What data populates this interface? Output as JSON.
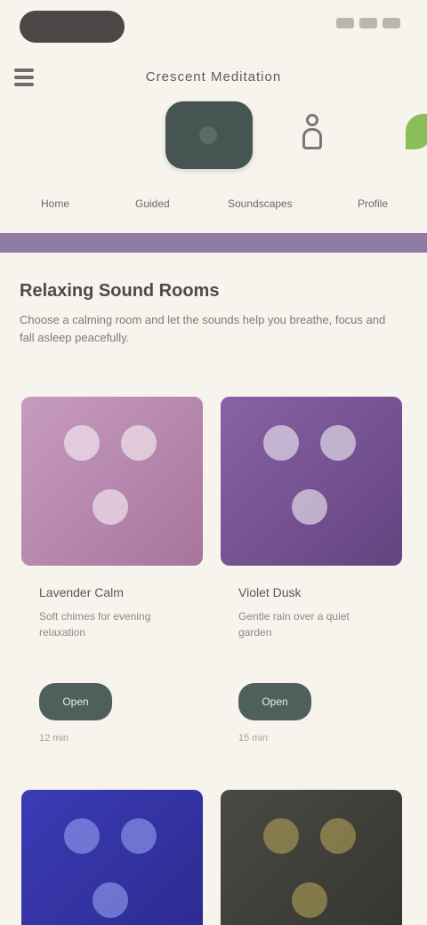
{
  "app": {
    "title": "Crescent Meditation"
  },
  "header": {
    "mode_label": ""
  },
  "tabs": [
    "Home",
    "Guided",
    "Soundscapes",
    "Profile"
  ],
  "section": {
    "title": "Relaxing Sound Rooms",
    "description": "Choose a calming room and let the sounds help you breathe, focus and fall asleep peacefully."
  },
  "cards": [
    {
      "name": "Lavender Calm",
      "meta": "Soft chimes for evening relaxation",
      "button": "Open",
      "caption": "12 min"
    },
    {
      "name": "Violet Dusk",
      "meta": "Gentle rain over a quiet garden",
      "button": "Open",
      "caption": "15 min"
    },
    {
      "name": "",
      "meta": "",
      "button": "",
      "caption": ""
    },
    {
      "name": "",
      "meta": "",
      "button": "",
      "caption": ""
    }
  ],
  "colors": {
    "background": "#f6f4ec",
    "accent": "#8f7ba3",
    "button": "#4f5f5b"
  }
}
